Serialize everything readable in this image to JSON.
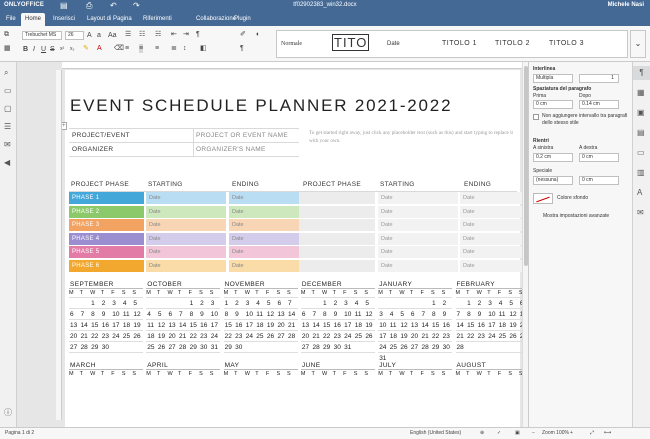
{
  "app": {
    "logo": "ONLYOFFICE",
    "doc_title": "tf02902383_win32.docx",
    "user": "Michele Nasi"
  },
  "menu": [
    "File",
    "Home",
    "Inserisci",
    "Layout di Pagina",
    "Riferimenti",
    "Collaborazione",
    "Plugin"
  ],
  "toolbar": {
    "font": "Trebuchet MS",
    "size": "26"
  },
  "styles": {
    "normal": "Normale",
    "title": "TITO",
    "date": "Date",
    "h1": "TITOLO 1",
    "h2": "TITOLO 2",
    "h3": "TITOLO 3"
  },
  "doc": {
    "title": "EVENT SCHEDULE PLANNER 2021-2022",
    "project_label": "PROJECT/EVENT",
    "project_value": "PROJECT OR EVENT NAME",
    "organizer_label": "ORGANIZER",
    "organizer_value": "ORGANIZER'S NAME",
    "hint": "To get started right away, just click any placeholder text (such as this) and start typing to replace it with your own.",
    "phase_header": "PROJECT PHASE",
    "starting_header": "STARTING",
    "ending_header": "ENDING",
    "date_placeholder": "Date",
    "phases": [
      {
        "label": "PHASE 1",
        "color": "#44a7d9",
        "light": "#b9ddf2"
      },
      {
        "label": "PHASE 2",
        "color": "#8cc96a",
        "light": "#cde8bd"
      },
      {
        "label": "PHASE 3",
        "color": "#f2a261",
        "light": "#f8d6b5"
      },
      {
        "label": "PHASE 4",
        "color": "#9b8ed0",
        "light": "#d3cdeb"
      },
      {
        "label": "PHASE 5",
        "color": "#e27ba6",
        "light": "#f2c6d8"
      },
      {
        "label": "PHASE 6",
        "color": "#f2a72e",
        "light": "#f9dca7"
      }
    ],
    "weekdays": [
      "M",
      "T",
      "W",
      "T",
      "F",
      "S",
      "S"
    ],
    "calendars_row1": [
      {
        "month": "SEPTEMBER",
        "rows": [
          [
            "",
            "",
            "1",
            "2",
            "3",
            "4",
            "5"
          ],
          [
            "6",
            "7",
            "8",
            "9",
            "10",
            "11",
            "12"
          ],
          [
            "13",
            "14",
            "15",
            "16",
            "17",
            "18",
            "19"
          ],
          [
            "20",
            "21",
            "22",
            "23",
            "24",
            "25",
            "26"
          ],
          [
            "27",
            "28",
            "29",
            "30",
            "",
            "",
            ""
          ],
          [
            "",
            "",
            "",
            "",
            "",
            "",
            ""
          ]
        ]
      },
      {
        "month": "OCTOBER",
        "rows": [
          [
            "",
            "",
            "",
            "",
            "1",
            "2",
            "3"
          ],
          [
            "4",
            "5",
            "6",
            "7",
            "8",
            "9",
            "10"
          ],
          [
            "11",
            "12",
            "13",
            "14",
            "15",
            "16",
            "17"
          ],
          [
            "18",
            "19",
            "20",
            "21",
            "22",
            "23",
            "24"
          ],
          [
            "25",
            "26",
            "27",
            "28",
            "29",
            "30",
            "31"
          ],
          [
            "",
            "",
            "",
            "",
            "",
            "",
            ""
          ]
        ]
      },
      {
        "month": "NOVEMBER",
        "rows": [
          [
            "1",
            "2",
            "3",
            "4",
            "5",
            "6",
            "7"
          ],
          [
            "8",
            "9",
            "10",
            "11",
            "12",
            "13",
            "14"
          ],
          [
            "15",
            "16",
            "17",
            "18",
            "19",
            "20",
            "21"
          ],
          [
            "22",
            "23",
            "24",
            "25",
            "26",
            "27",
            "28"
          ],
          [
            "29",
            "30",
            "",
            "",
            "",
            "",
            ""
          ],
          [
            "",
            "",
            "",
            "",
            "",
            "",
            ""
          ]
        ]
      },
      {
        "month": "DECEMBER",
        "rows": [
          [
            "",
            "",
            "1",
            "2",
            "3",
            "4",
            "5"
          ],
          [
            "6",
            "7",
            "8",
            "9",
            "10",
            "11",
            "12"
          ],
          [
            "13",
            "14",
            "15",
            "16",
            "17",
            "18",
            "19"
          ],
          [
            "20",
            "21",
            "22",
            "23",
            "24",
            "25",
            "26"
          ],
          [
            "27",
            "28",
            "29",
            "30",
            "31",
            "",
            ""
          ],
          [
            "",
            "",
            "",
            "",
            "",
            "",
            ""
          ]
        ]
      },
      {
        "month": "JANUARY",
        "rows": [
          [
            "",
            "",
            "",
            "",
            "",
            "1",
            "2"
          ],
          [
            "3",
            "4",
            "5",
            "6",
            "7",
            "8",
            "9"
          ],
          [
            "10",
            "11",
            "12",
            "13",
            "14",
            "15",
            "16"
          ],
          [
            "17",
            "18",
            "19",
            "20",
            "21",
            "22",
            "23"
          ],
          [
            "24",
            "25",
            "26",
            "27",
            "28",
            "29",
            "30"
          ],
          [
            "31",
            "",
            "",
            "",
            "",
            "",
            ""
          ]
        ]
      },
      {
        "month": "FEBRUARY",
        "rows": [
          [
            "",
            "1",
            "2",
            "3",
            "4",
            "5",
            "6"
          ],
          [
            "7",
            "8",
            "9",
            "10",
            "11",
            "12",
            "13"
          ],
          [
            "14",
            "15",
            "16",
            "17",
            "18",
            "19",
            "20"
          ],
          [
            "21",
            "22",
            "23",
            "24",
            "25",
            "26",
            "27"
          ],
          [
            "28",
            "",
            "",
            "",
            "",
            "",
            ""
          ],
          [
            "",
            "",
            "",
            "",
            "",
            "",
            ""
          ]
        ]
      }
    ],
    "calendars_row2": [
      "MARCH",
      "APRIL",
      "MAY",
      "JUNE",
      "JULY",
      "AUGUST"
    ]
  },
  "panel": {
    "interlinea": "Interlinea",
    "line_mode": "Multipla",
    "line_value": "1",
    "spacing": "Spaziatura del paragrafo",
    "before": "Prima",
    "after": "Dopo",
    "before_val": "0 cm",
    "after_val": "0.14 cm",
    "no_space": "Non aggiungere intervallo tra paragrafi dello stesso stile",
    "indent": "Rientri",
    "left": "A sinistra",
    "right": "A destra",
    "left_val": "0.2 cm",
    "right_val": "0 cm",
    "special": "Speciale",
    "special_val": "(nessuna)",
    "special_num": "0 cm",
    "bg": "Colore sfondo",
    "advanced": "Mostra impostazioni avanzate"
  },
  "status": {
    "page": "Pagina 1 di 2",
    "lang": "English (United States)",
    "zoom": "Zoom 100%"
  }
}
